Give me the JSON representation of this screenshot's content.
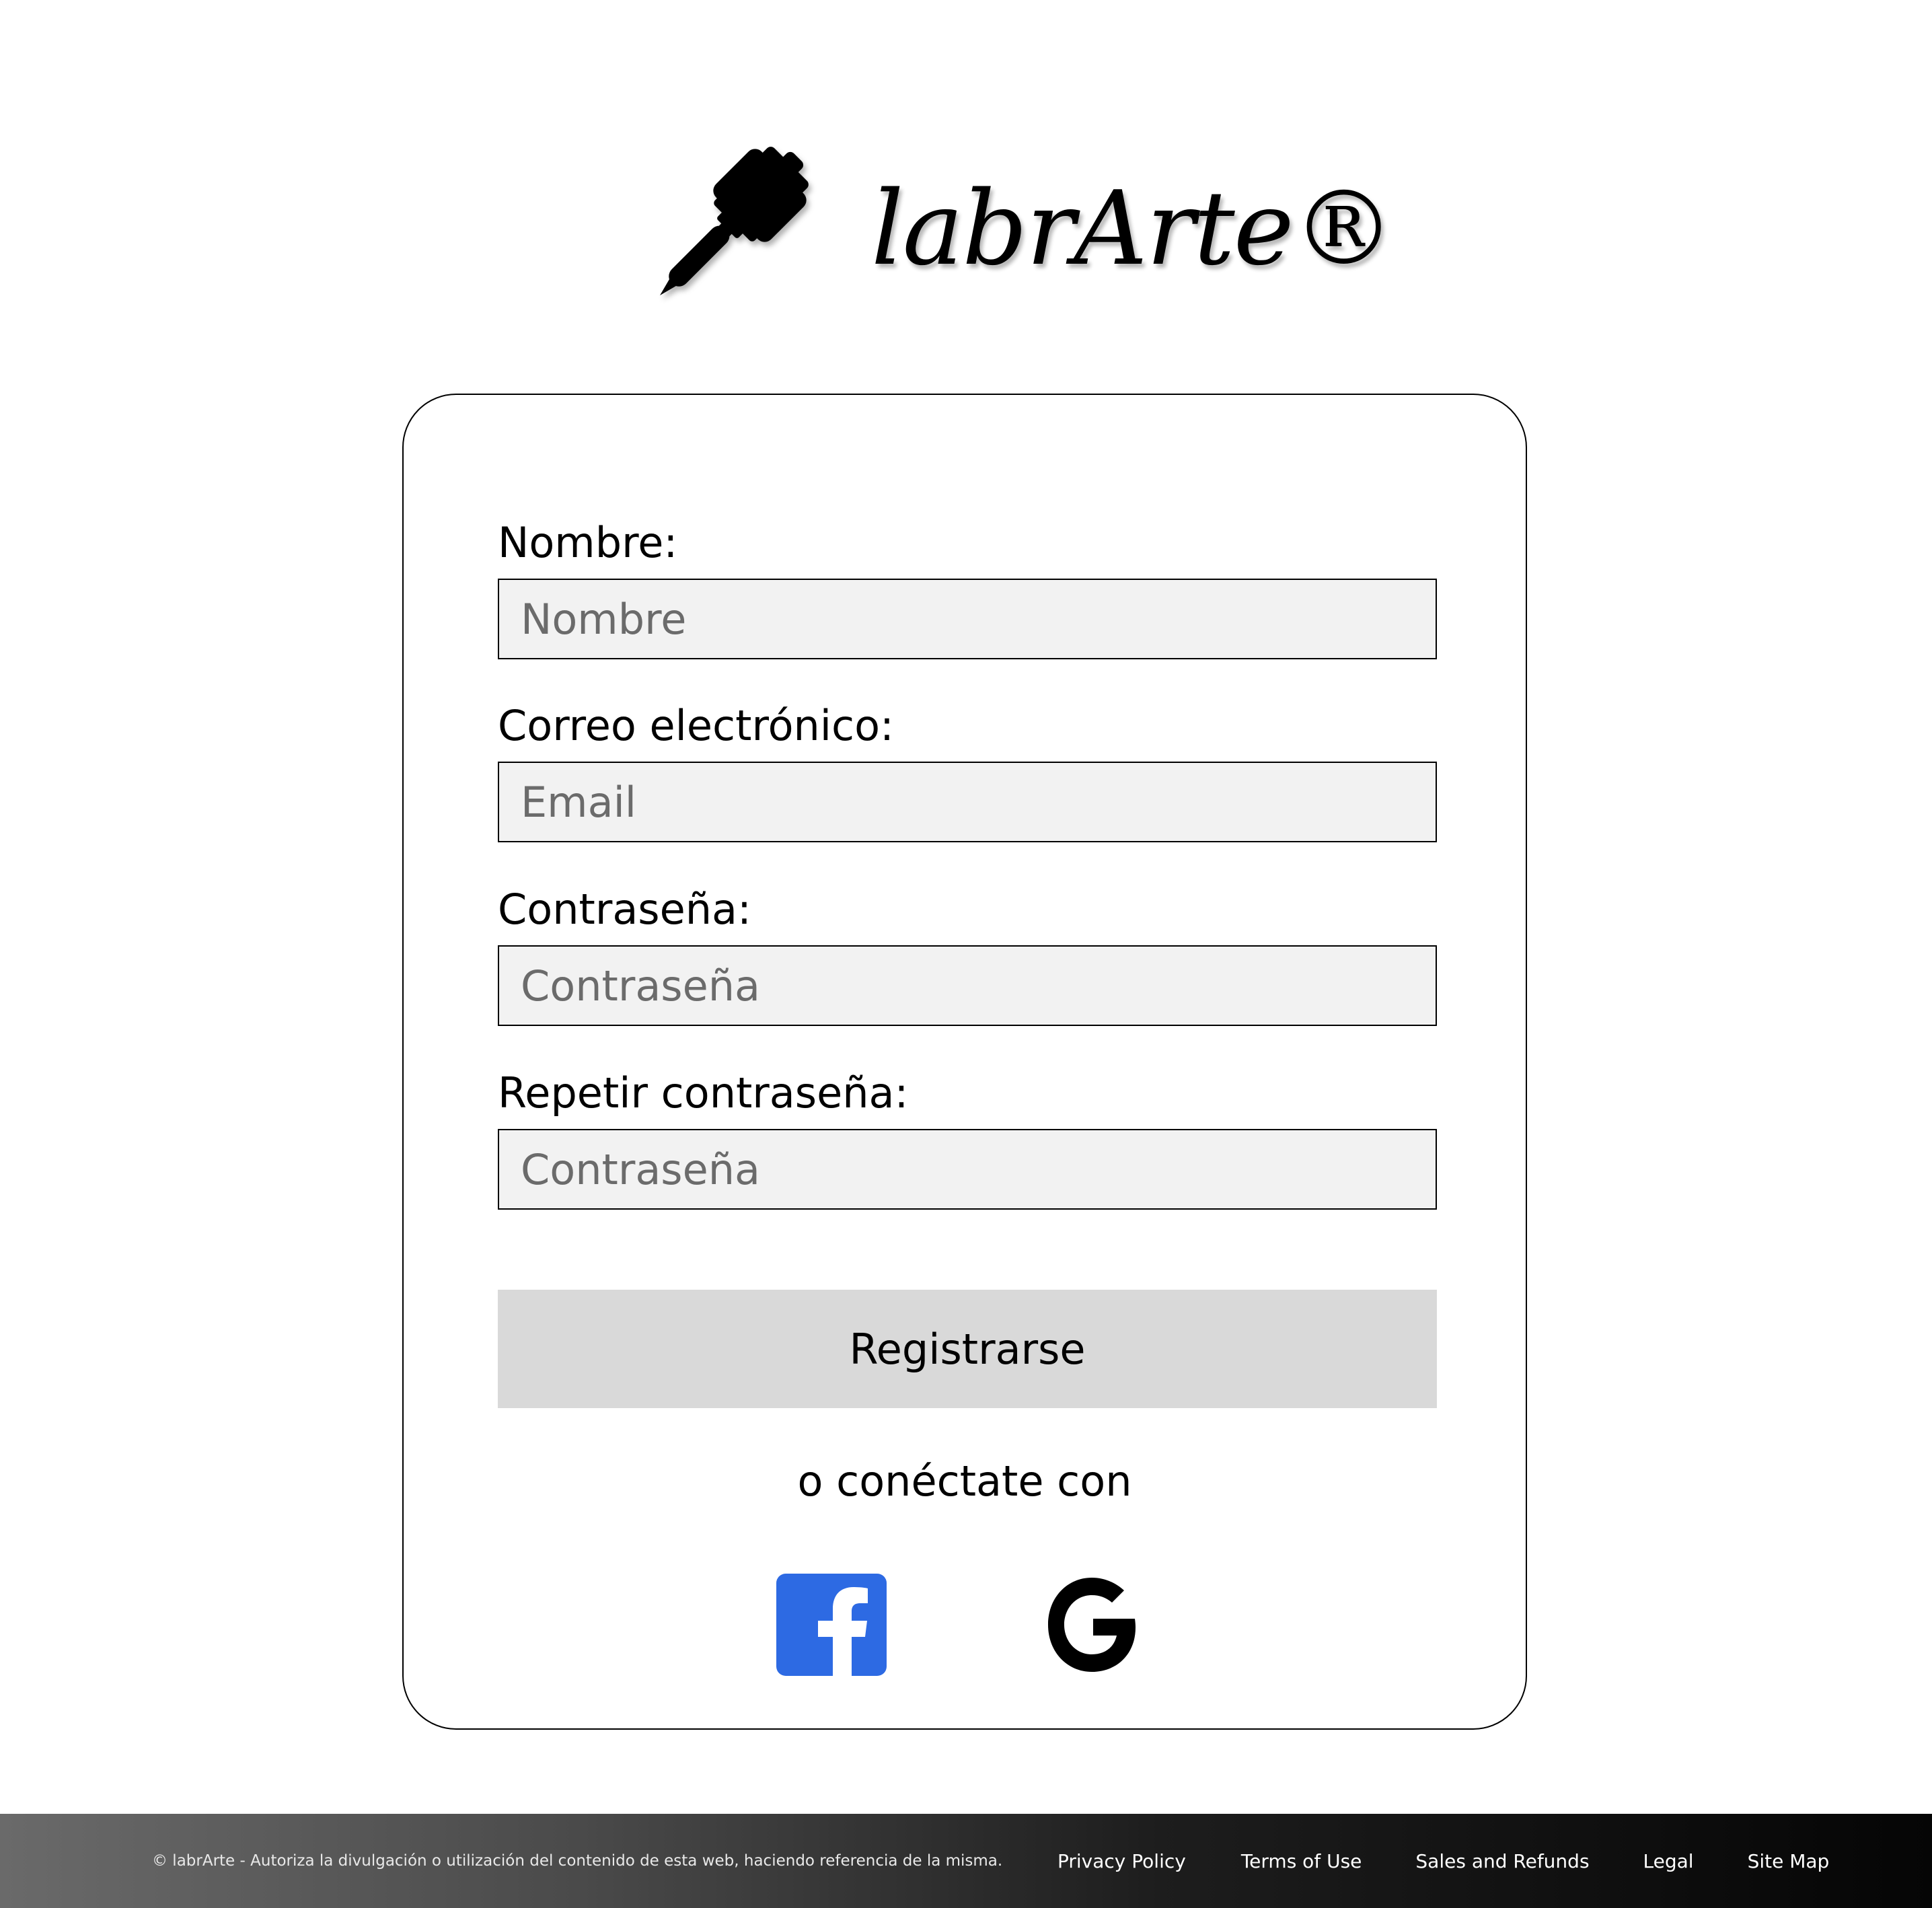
{
  "logo": {
    "brand_text": "labrArte®",
    "icon": "hammer-chisel-icon"
  },
  "form": {
    "name": {
      "label": "Nombre:",
      "placeholder": "Nombre"
    },
    "email": {
      "label": "Correo electrónico:",
      "placeholder": "Email"
    },
    "password": {
      "label": "Contraseña:",
      "placeholder": "Contraseña"
    },
    "repeat_password": {
      "label": "Repetir contraseña:",
      "placeholder": "Contraseña"
    },
    "submit_label": "Registrarse",
    "connect_text": "o conéctate con",
    "social": [
      {
        "icon": "facebook-icon",
        "color": "#2d6ae3"
      },
      {
        "icon": "google-icon",
        "color": "#000000"
      }
    ]
  },
  "footer": {
    "copyright": "© labrArte - Autoriza la divulgación o utilización del contenido de esta web, haciendo referencia de la misma.",
    "links": {
      "privacy": "Privacy Policy",
      "terms": "Terms of Use",
      "sales": "Sales and Refunds",
      "legal": "Legal",
      "sitemap": "Site Map"
    }
  }
}
